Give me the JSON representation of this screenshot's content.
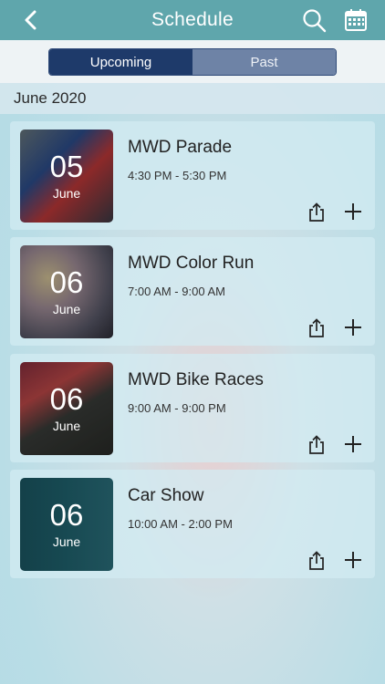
{
  "header": {
    "title": "Schedule",
    "icons": [
      "back-icon",
      "search-icon",
      "calendar-icon"
    ],
    "color": "#5fa6ac"
  },
  "tabs": {
    "upcoming": "Upcoming",
    "past": "Past",
    "active": "Upcoming"
  },
  "month": "June 2020",
  "events": [
    {
      "day": "05",
      "month": "June",
      "title": "MWD Parade",
      "time": "4:30 PM - 5:30 PM"
    },
    {
      "day": "06",
      "month": "June",
      "title": "MWD Color Run",
      "time": "7:00 AM - 9:00 AM"
    },
    {
      "day": "06",
      "month": "June",
      "title": "MWD Bike Races",
      "time": "9:00 AM - 9:00 PM"
    },
    {
      "day": "06",
      "month": "June",
      "title": "Car Show",
      "time": "10:00 AM - 2:00 PM"
    }
  ]
}
